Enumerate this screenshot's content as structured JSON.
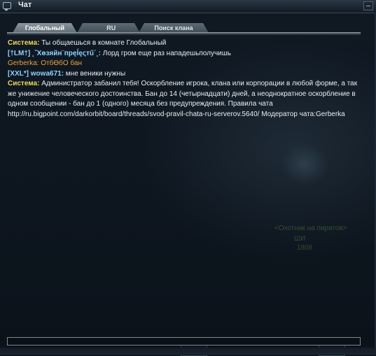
{
  "window": {
    "title": "Чат",
    "icon": "chat-icon",
    "close_icon": "minimize-icon"
  },
  "tabs": [
    {
      "label": "Глобальный",
      "active": true
    },
    {
      "label": "   RU",
      "active": false
    },
    {
      "label": "Поиск клана",
      "active": false
    }
  ],
  "messages": [
    {
      "sender": "Система:",
      "text": " Ты общаешься в комнате Глобальный",
      "style": "system"
    },
    {
      "sender": "[†LM†] ˛ˇХөзяйн¨прęĺęςтű´¸:",
      "text": " Лорд гром еще раз нападешьполучишь",
      "style": "blue"
    },
    {
      "sender": "Gerberka:",
      "text": " ОтбӨбО бан",
      "style": "orange"
    },
    {
      "sender": "[XXL*] wowa671:",
      "text": " мне веники нужны",
      "style": "blue"
    },
    {
      "sender": "Система:",
      "text": " Администратор забанил тебя! Оскорбление игрока, клана или корпорации в любой форме, а так же унижение человеческого достоинства. Бан до 14 (четырнадцати) дней, а неоднократное оскорбление в одном сообщении - бан до 1 (одного) месяца без предупреждения. Правила чата http://ru.bigpoint.com/darkorbit/board/threads/svod-pravil-chata-ru-serverov.5640/ Модератор чата:Gerberka",
      "style": "system"
    }
  ],
  "background_labels": {
    "ghost_title": "<Охотник на пиратов>",
    "ghost_line2": "ШИ",
    "ghost_line3": "1808"
  },
  "input": {
    "value": ""
  },
  "colors": {
    "system": "#f0d85a",
    "player": "#8fd4ff",
    "moderator": "#e8a33c",
    "text": "#e8edf1"
  }
}
